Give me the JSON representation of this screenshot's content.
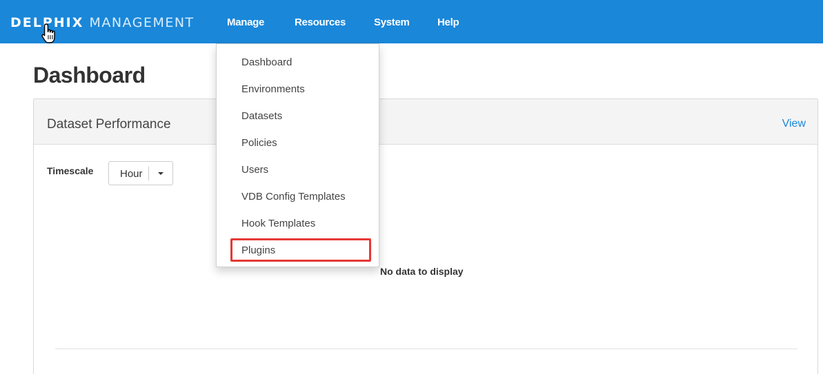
{
  "navbar": {
    "brand_bold": "DELPHIX",
    "brand_light": "MANAGEMENT",
    "items": [
      "Manage",
      "Resources",
      "System",
      "Help"
    ]
  },
  "page": {
    "title": "Dashboard"
  },
  "panel": {
    "title": "Dataset Performance",
    "link": "View",
    "timescale_label": "Timescale",
    "timescale_value": "Hour",
    "empty_message": "No data to display"
  },
  "manage_menu": {
    "items": [
      "Dashboard",
      "Environments",
      "Datasets",
      "Policies",
      "Users",
      "VDB Config Templates",
      "Hook Templates",
      "Plugins"
    ],
    "highlighted": "Plugins"
  },
  "colors": {
    "navbar": "#1a87d9",
    "link": "#1a87d9",
    "highlight_border": "#e53935"
  },
  "icons": [
    "hand-pointer-icon",
    "caret-down-icon"
  ]
}
